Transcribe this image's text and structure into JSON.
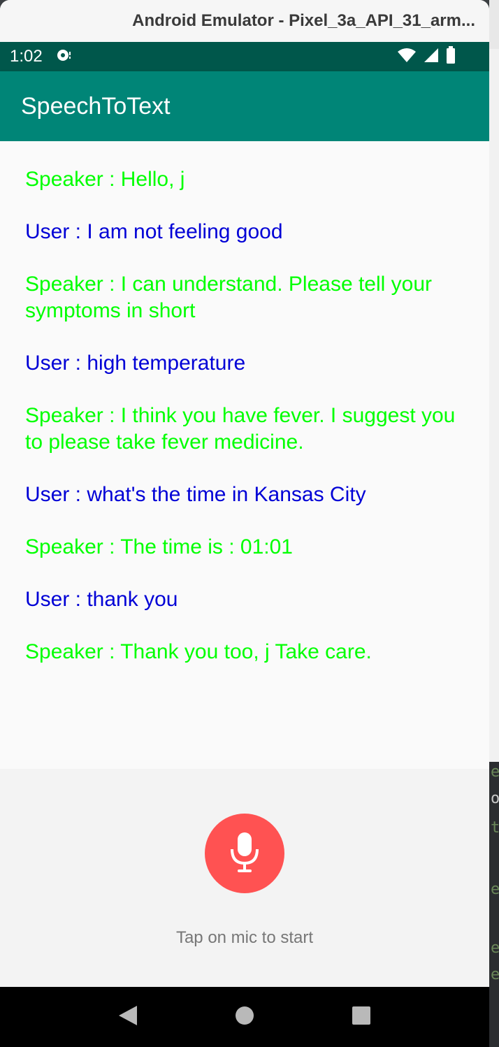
{
  "window": {
    "title": "Android Emulator - Pixel_3a_API_31_arm..."
  },
  "status_bar": {
    "time": "1:02",
    "icons": [
      "media-notification-icon",
      "wifi-icon",
      "signal-icon",
      "battery-icon"
    ]
  },
  "app_bar": {
    "title": "SpeechToText",
    "color": "#008577"
  },
  "conversation": [
    {
      "role": "speaker",
      "text": "Speaker : Hello, j"
    },
    {
      "role": "user",
      "text": "User : I am not feeling good"
    },
    {
      "role": "speaker",
      "text": "Speaker : I can understand. Please tell your symptoms in short"
    },
    {
      "role": "user",
      "text": "User : high temperature"
    },
    {
      "role": "speaker",
      "text": "Speaker : I think you have fever. I suggest you to please take fever medicine."
    },
    {
      "role": "user",
      "text": "User : what's the time in Kansas City"
    },
    {
      "role": "speaker",
      "text": "Speaker : The time is : 01:01"
    },
    {
      "role": "user",
      "text": "User : thank you"
    },
    {
      "role": "speaker",
      "text": "Speaker : Thank you too, j Take care."
    }
  ],
  "colors": {
    "speaker_text": "#00ff00",
    "user_text": "#0000d6",
    "mic_button": "#ff5252"
  },
  "mic": {
    "icon": "microphone-icon",
    "hint": "Tap on mic to start"
  },
  "nav_bar": {
    "buttons": [
      "back-icon",
      "home-icon",
      "recents-icon"
    ]
  }
}
